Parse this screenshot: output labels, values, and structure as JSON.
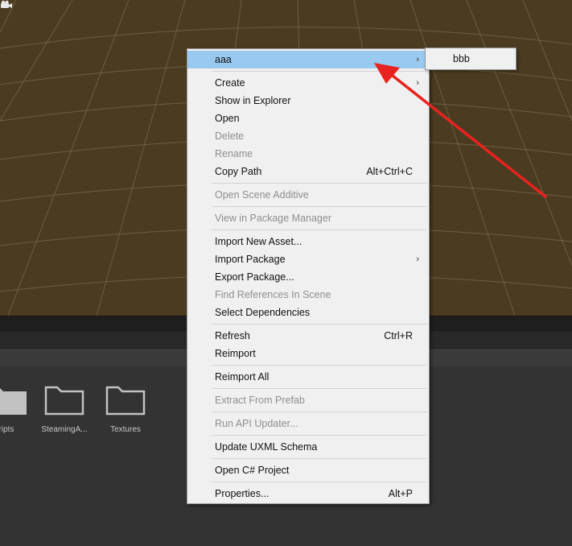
{
  "context_menu": {
    "items": [
      {
        "label": "aaa",
        "submenu": true,
        "highlighted": true
      },
      {
        "separator": true
      },
      {
        "label": "Create",
        "submenu": true
      },
      {
        "label": "Show in Explorer"
      },
      {
        "label": "Open"
      },
      {
        "label": "Delete",
        "disabled": true
      },
      {
        "label": "Rename",
        "disabled": true
      },
      {
        "label": "Copy Path",
        "shortcut": "Alt+Ctrl+C"
      },
      {
        "separator": true
      },
      {
        "label": "Open Scene Additive",
        "disabled": true
      },
      {
        "separator": true
      },
      {
        "label": "View in Package Manager",
        "disabled": true
      },
      {
        "separator": true
      },
      {
        "label": "Import New Asset..."
      },
      {
        "label": "Import Package",
        "submenu": true
      },
      {
        "label": "Export Package..."
      },
      {
        "label": "Find References In Scene",
        "disabled": true
      },
      {
        "label": "Select Dependencies"
      },
      {
        "separator": true
      },
      {
        "label": "Refresh",
        "shortcut": "Ctrl+R"
      },
      {
        "label": "Reimport"
      },
      {
        "separator": true
      },
      {
        "label": "Reimport All"
      },
      {
        "separator": true
      },
      {
        "label": "Extract From Prefab",
        "disabled": true
      },
      {
        "separator": true
      },
      {
        "label": "Run API Updater...",
        "disabled": true
      },
      {
        "separator": true
      },
      {
        "label": "Update UXML Schema"
      },
      {
        "separator": true
      },
      {
        "label": "Open C# Project"
      },
      {
        "separator": true
      },
      {
        "label": "Properties...",
        "shortcut": "Alt+P"
      }
    ]
  },
  "submenu": {
    "items": [
      {
        "label": "bbb"
      }
    ]
  },
  "submenu_arrow_glyph": "›",
  "project": {
    "assets": [
      {
        "label": "ripts",
        "icon": "folder-icon"
      },
      {
        "label": "SteamingA...",
        "icon": "folder-icon"
      },
      {
        "label": "Textures",
        "icon": "folder-icon"
      }
    ]
  },
  "colors": {
    "menu_bg": "#f0f0f0",
    "highlight": "#99c9ef",
    "disabled_text": "#8f8f8f",
    "annotation_arrow": "#e8231f",
    "scene_bg": "#4a3b20"
  }
}
